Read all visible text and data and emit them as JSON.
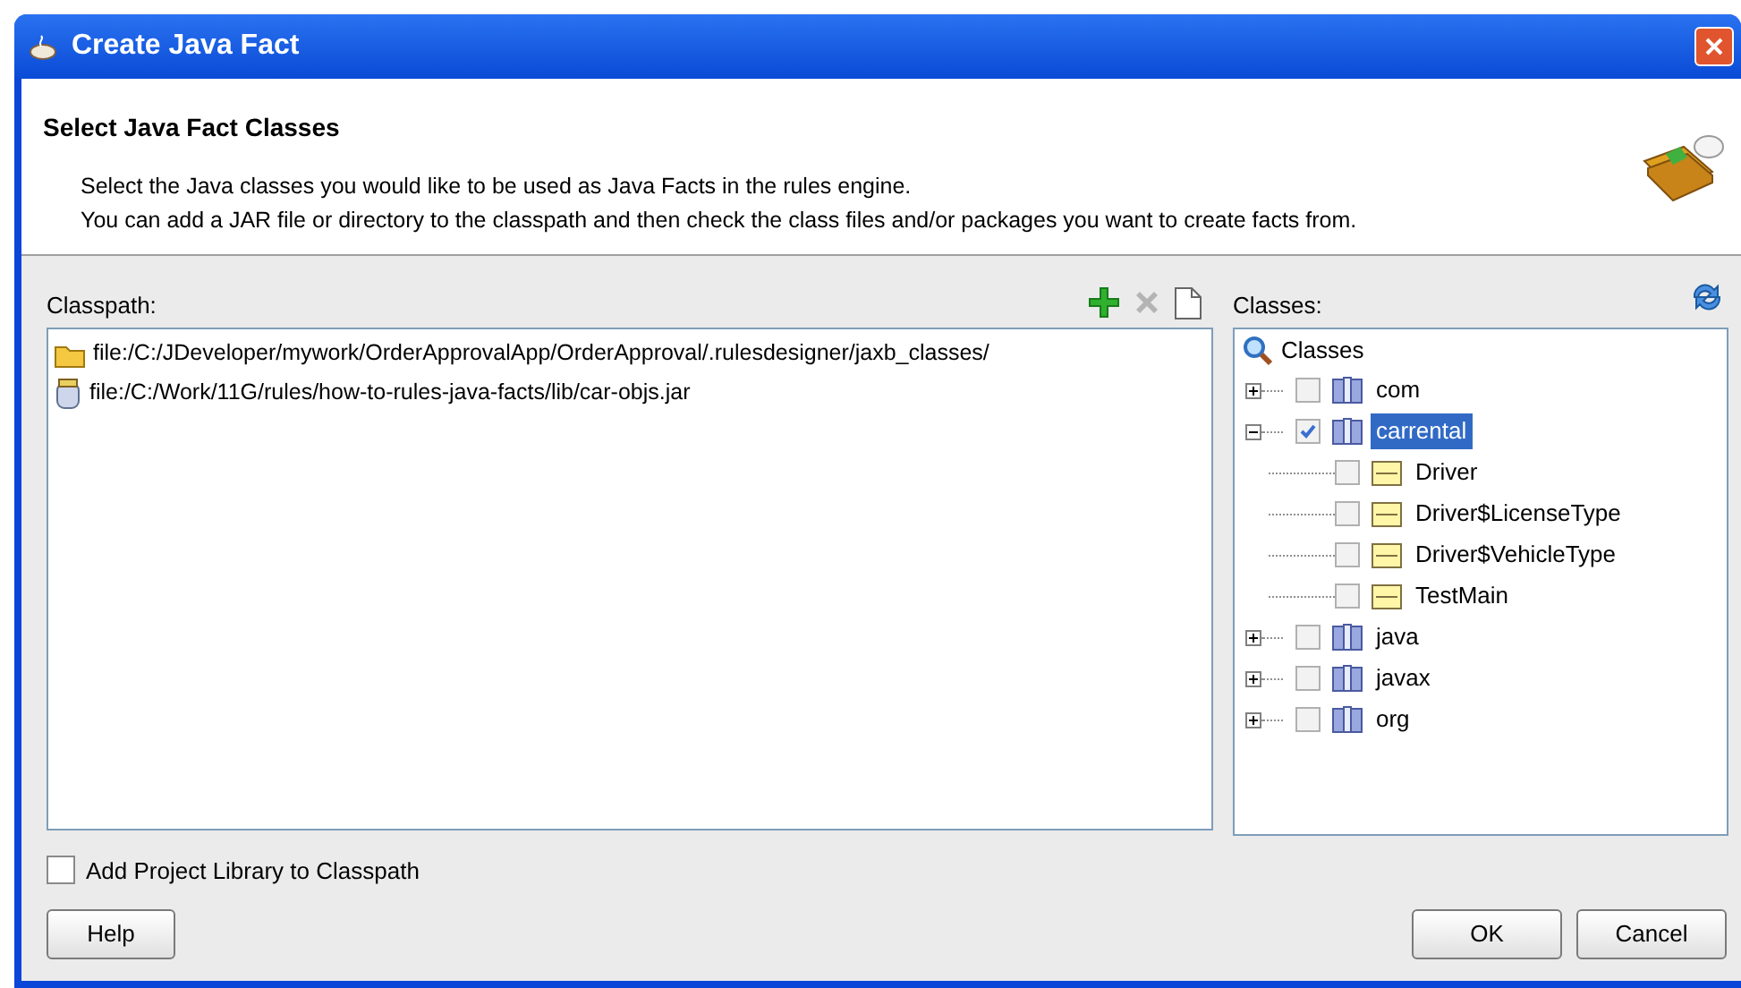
{
  "window": {
    "title": "Create Java Fact"
  },
  "header": {
    "title": "Select Java Fact Classes",
    "lines": [
      "Select the Java classes you would like to be used as Java Facts in the rules engine.",
      "You can add a JAR file or directory to the classpath and then check the class files and/or packages you want to create facts from."
    ]
  },
  "classpath": {
    "label": "Classpath:",
    "toolbar": [
      {
        "kind": "add",
        "disabled": false
      },
      {
        "kind": "remove",
        "disabled": true
      },
      {
        "kind": "new",
        "disabled": false
      }
    ],
    "entries": [
      {
        "kind": "folder",
        "path": "file:/C:/JDeveloper/mywork/OrderApprovalApp/OrderApproval/.rulesdesigner/jaxb_classes/"
      },
      {
        "kind": "jar",
        "path": "file:/C:/Work/11G/rules/how-to-rules-java-facts/lib/car-objs.jar"
      }
    ]
  },
  "classes": {
    "label": "Classes:",
    "root": "Classes",
    "tree": [
      {
        "label": "com",
        "kind": "package",
        "checked": false,
        "expanded": false,
        "selected": false
      },
      {
        "label": "carrental",
        "kind": "package",
        "checked": true,
        "expanded": true,
        "selected": true,
        "children": [
          {
            "label": "Driver",
            "kind": "class",
            "checked": false,
            "selected": false
          },
          {
            "label": "Driver$LicenseType",
            "kind": "class",
            "checked": false,
            "selected": false
          },
          {
            "label": "Driver$VehicleType",
            "kind": "class",
            "checked": false,
            "selected": false
          },
          {
            "label": "TestMain",
            "kind": "class",
            "checked": false,
            "selected": false
          }
        ]
      },
      {
        "label": "java",
        "kind": "package",
        "checked": false,
        "expanded": false,
        "selected": false
      },
      {
        "label": "javax",
        "kind": "package",
        "checked": false,
        "expanded": false,
        "selected": false
      },
      {
        "label": "org",
        "kind": "package",
        "checked": false,
        "expanded": false,
        "selected": false
      }
    ]
  },
  "add_project_library": {
    "label": "Add Project Library to Classpath",
    "checked": false
  },
  "buttons": [
    {
      "label": "Help",
      "kind": "help"
    },
    {
      "label": "OK",
      "kind": "ok"
    },
    {
      "label": "Cancel",
      "kind": "cancel"
    }
  ]
}
